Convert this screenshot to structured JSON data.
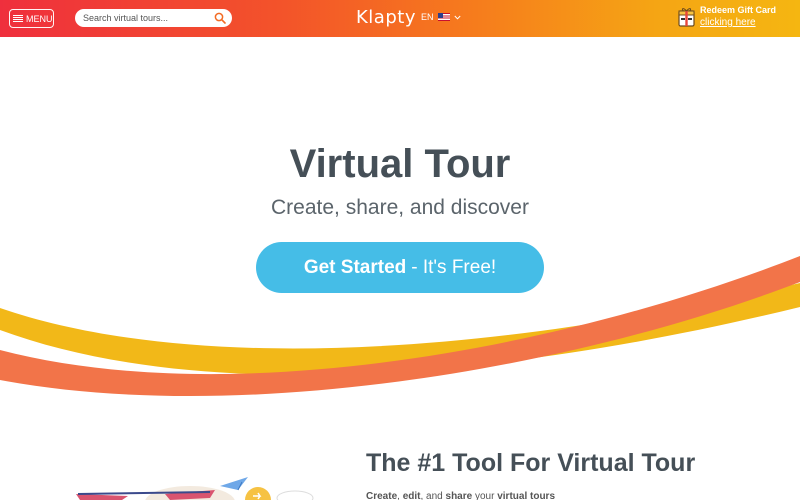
{
  "header": {
    "menu_label": "MENU",
    "search_placeholder": "Search virtual tours...",
    "logo_text": "Klapty",
    "language": "EN",
    "gift_title": "Redeem Gift Card",
    "gift_link": "clicking here"
  },
  "hero": {
    "title": "Virtual Tour",
    "subtitle": "Create, share, and discover",
    "cta_strong": "Get Started",
    "cta_rest": "- It's Free!"
  },
  "section": {
    "title": "The #1 Tool For Virtual Tour",
    "desc_create": "Create",
    "desc_edit": "edit",
    "desc_and": ", and",
    "desc_share": "share",
    "desc_your": "your",
    "desc_tours": "virtual tours"
  },
  "icons": {
    "menu": "hamburger-icon",
    "search": "search-icon",
    "language_flag": "us-flag-icon",
    "language_chevron": "chevron-down-icon",
    "gift": "gift-card-icon"
  },
  "colors": {
    "header_start": "#ef2f3d",
    "header_end": "#f5b611",
    "cta": "#45bde7",
    "wave_yellow": "#f2b818",
    "wave_orange": "#f27449",
    "text_dark": "#454f57"
  }
}
